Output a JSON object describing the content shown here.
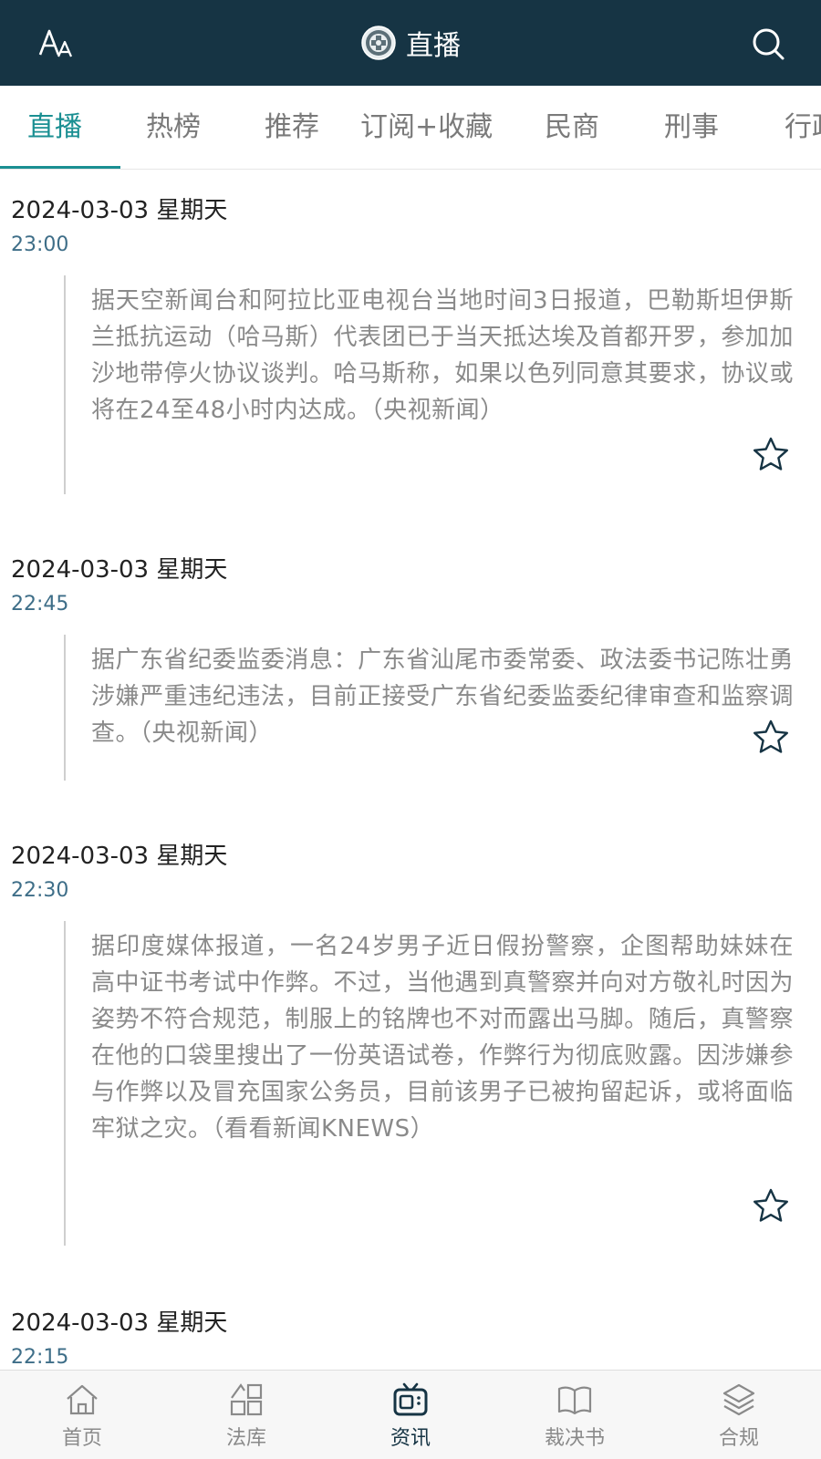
{
  "header": {
    "title": "直播",
    "left_icon": "font-size-icon",
    "logo_icon": "court-emblem-icon",
    "right_icon": "search-icon"
  },
  "tabs": [
    {
      "label": "直播",
      "active": true
    },
    {
      "label": "热榜",
      "active": false
    },
    {
      "label": "推荐",
      "active": false
    },
    {
      "label": "订阅+收藏",
      "active": false
    },
    {
      "label": "民商",
      "active": false
    },
    {
      "label": "刑事",
      "active": false
    },
    {
      "label": "行政",
      "active": false
    }
  ],
  "feed": [
    {
      "date": "2024-03-03 星期天",
      "time": "23:00",
      "content": "据天空新闻台和阿拉比亚电视台当地时间3日报道，巴勒斯坦伊斯兰抵抗运动（哈马斯）代表团已于当天抵达埃及首都开罗，参加加沙地带停火协议谈判。哈马斯称，如果以色列同意其要求，协议或将在24至48小时内达成。（央视新闻）"
    },
    {
      "date": "2024-03-03 星期天",
      "time": "22:45",
      "content": "据广东省纪委监委消息：广东省汕尾市委常委、政法委书记陈壮勇涉嫌严重违纪违法，目前正接受广东省纪委监委纪律审查和监察调查。（央视新闻）"
    },
    {
      "date": "2024-03-03 星期天",
      "time": "22:30",
      "content": "据印度媒体报道，一名24岁男子近日假扮警察，企图帮助妹妹在高中证书考试中作弊。不过，当他遇到真警察并向对方敬礼时因为姿势不符合规范，制服上的铭牌也不对而露出马脚。随后，真警察在他的口袋里搜出了一份英语试卷，作弊行为彻底败露。因涉嫌参与作弊以及冒充国家公务员，目前该男子已被拘留起诉，或将面临牢狱之灾。（看看新闻KNEWS）"
    },
    {
      "date": "2024-03-03 星期天",
      "time": "22:15",
      "content": ""
    }
  ],
  "bottom_nav": [
    {
      "label": "首页",
      "icon": "home-icon",
      "active": false
    },
    {
      "label": "法库",
      "icon": "library-icon",
      "active": false
    },
    {
      "label": "资讯",
      "icon": "news-tv-icon",
      "active": true
    },
    {
      "label": "裁决书",
      "icon": "book-icon",
      "active": false
    },
    {
      "label": "合规",
      "icon": "layers-icon",
      "active": false
    }
  ],
  "colors": {
    "header_bg": "#163444",
    "accent": "#1a8f92",
    "time_text": "#3e6e88",
    "body_text": "#8a8a8a"
  }
}
